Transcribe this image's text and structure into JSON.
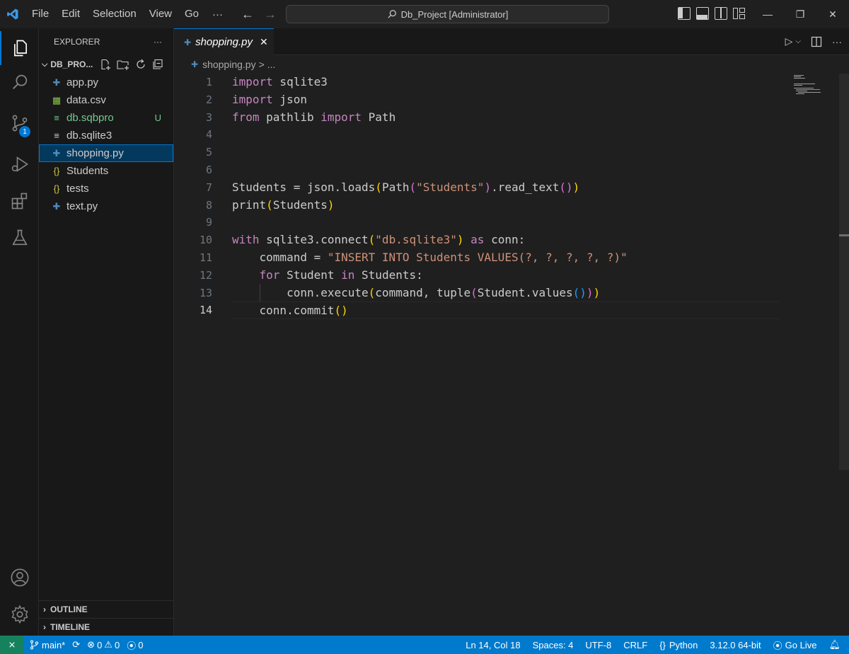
{
  "titlebar": {
    "menus": [
      "File",
      "Edit",
      "Selection",
      "View",
      "Go"
    ],
    "more": "···",
    "search_text": "Db_Project [Administrator]"
  },
  "activity": {
    "scm_badge": "1"
  },
  "sidebar": {
    "title": "EXPLORER",
    "more": "···",
    "folder": "DB_PRO...",
    "files": [
      {
        "name": "app.py",
        "icon": "python-icon",
        "git": ""
      },
      {
        "name": "data.csv",
        "icon": "csv-icon",
        "git": ""
      },
      {
        "name": "db.sqbpro",
        "icon": "lines-icon",
        "git": "U"
      },
      {
        "name": "db.sqlite3",
        "icon": "lines-icon",
        "git": ""
      },
      {
        "name": "shopping.py",
        "icon": "python-icon",
        "git": ""
      },
      {
        "name": "Students",
        "icon": "json-icon",
        "git": ""
      },
      {
        "name": "tests",
        "icon": "json-icon",
        "git": ""
      },
      {
        "name": "text.py",
        "icon": "python-icon",
        "git": ""
      }
    ],
    "outline": "OUTLINE",
    "timeline": "TIMELINE"
  },
  "editor": {
    "tab_label": "shopping.py",
    "breadcrumb_file": "shopping.py",
    "breadcrumb_sep": ">",
    "breadcrumb_more": "...",
    "line_numbers": [
      "1",
      "2",
      "3",
      "4",
      "5",
      "6",
      "7",
      "8",
      "9",
      "10",
      "11",
      "12",
      "13",
      "14"
    ],
    "current_line": 14
  },
  "statusbar": {
    "branch": "main*",
    "errors": "0",
    "warnings": "0",
    "ports": "0",
    "position": "Ln 14, Col 18",
    "spaces": "Spaces: 4",
    "encoding": "UTF-8",
    "eol": "CRLF",
    "language": "Python",
    "interpreter": "3.12.0 64-bit",
    "golive": "Go Live"
  },
  "colors": {
    "accent": "#0078d4",
    "statusbar": "#007acc",
    "remote": "#16825d",
    "untracked": "#73c991"
  }
}
